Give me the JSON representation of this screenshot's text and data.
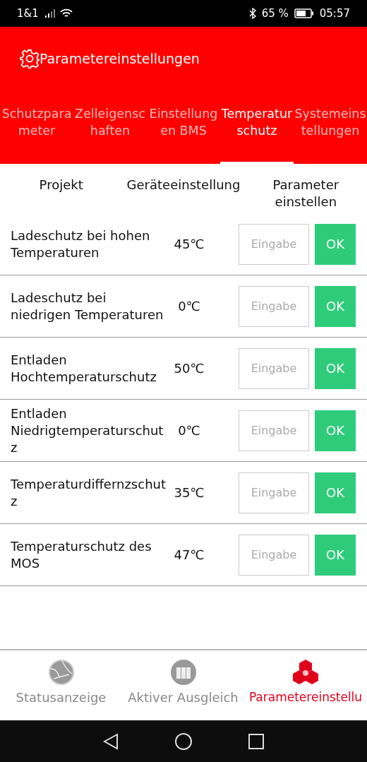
{
  "status_bar": {
    "carrier": "1&1",
    "battery": "65 %",
    "time": "05:57"
  },
  "header": {
    "title": "Parametereinstellungen"
  },
  "tabs": [
    {
      "label": "Schutzparameter",
      "selected": false
    },
    {
      "label": "Zelleigenschaften",
      "selected": false
    },
    {
      "label": "Einstellungen BMS",
      "selected": false
    },
    {
      "label": "Temperaturschutz",
      "selected": true
    },
    {
      "label": "Systemeinstellungen",
      "selected": false
    }
  ],
  "table": {
    "columns": [
      "Projekt",
      "Geräteeinstellung",
      "Parameter einstellen"
    ],
    "rows": [
      {
        "name": "Ladeschutz bei hohen Temperaturen",
        "value": "45℃",
        "placeholder": "Eingabe",
        "button": "OK"
      },
      {
        "name": "Ladeschutz bei niedrigen Temperaturen",
        "value": "0℃",
        "placeholder": "Eingabe",
        "button": "OK"
      },
      {
        "name": "Entladen Hochtemperaturschutz",
        "value": "50℃",
        "placeholder": "Eingabe",
        "button": "OK"
      },
      {
        "name": "Entladen Niedrigtemperaturschutz",
        "value": "0℃",
        "placeholder": "Eingabe",
        "button": "OK"
      },
      {
        "name": "Temperaturdiffernzschutz",
        "value": "35℃",
        "placeholder": "Eingabe",
        "button": "OK"
      },
      {
        "name": "Temperaturschutz des MOS",
        "value": "47℃",
        "placeholder": "Eingabe",
        "button": "OK"
      }
    ]
  },
  "bottom_nav": [
    {
      "label": "Statusanzeige",
      "kind": "globe",
      "selected": false
    },
    {
      "label": "Aktiver Ausgleich",
      "kind": "cells",
      "selected": false
    },
    {
      "label": "Parametereinstellu",
      "kind": "cubes",
      "selected": true
    }
  ]
}
